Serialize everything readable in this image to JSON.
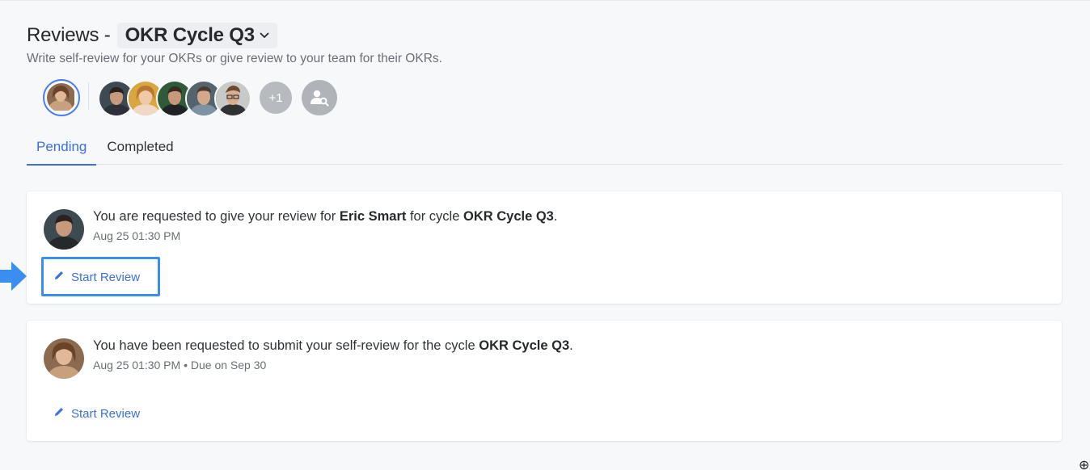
{
  "header": {
    "title_prefix": "Reviews -",
    "cycle_label": "OKR Cycle Q3",
    "subtitle": "Write self-review for your OKRs or give review to your team for their OKRs."
  },
  "people": {
    "overflow_count": "+1",
    "find_icon": "user-search-icon"
  },
  "tabs": [
    {
      "label": "Pending",
      "active": true
    },
    {
      "label": "Completed",
      "active": false
    }
  ],
  "reviews": [
    {
      "msg_prefix": "You are requested to give your review for ",
      "person": "Eric Smart",
      "msg_mid": " for cycle ",
      "cycle": "OKR Cycle Q3",
      "msg_suffix": ".",
      "timestamp": "Aug 25 01:30 PM",
      "action_label": "Start Review"
    },
    {
      "msg_prefix": "You have been requested to submit your self-review for the cycle ",
      "cycle": "OKR Cycle Q3",
      "msg_suffix": ".",
      "timestamp": "Aug 25 01:30 PM",
      "separator": " • ",
      "due_label": "Due on Sep 30",
      "action_label": "Start Review"
    }
  ],
  "colors": {
    "accent": "#3a70e0",
    "highlight": "#3a8ef0",
    "background": "#f7f8fa"
  }
}
